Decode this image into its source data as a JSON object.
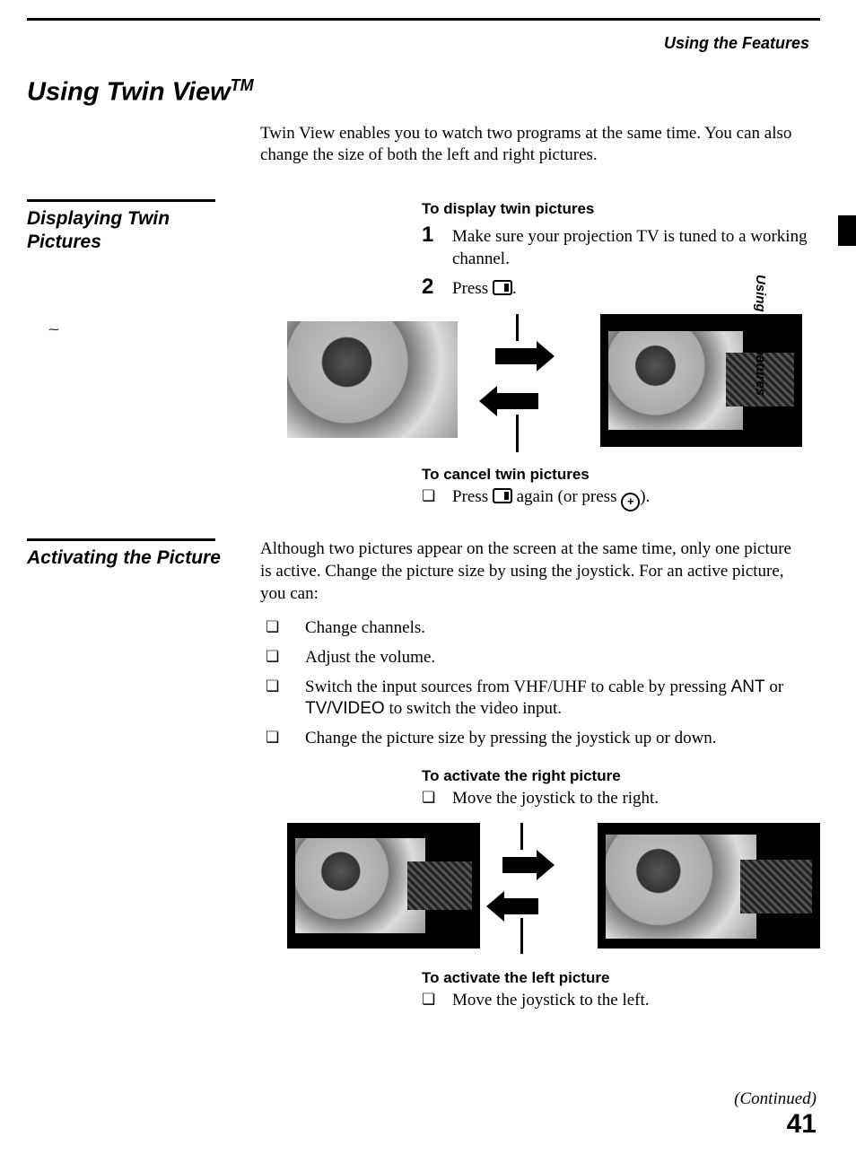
{
  "running_head": "Using the Features",
  "thumb_label": "Using the Features",
  "title_main": "Using Twin View",
  "title_tm": "TM",
  "intro": "Twin View enables you to watch two programs at the same time. You can also change the size of both the left and right pictures.",
  "section1": {
    "side_title": "Displaying Twin Pictures",
    "heading_a": "To display twin pictures",
    "steps": [
      {
        "n": "1",
        "t": "Make sure your projection TV is tuned to a working channel."
      },
      {
        "n": "2",
        "t_before": "Press ",
        "t_after": "."
      }
    ],
    "heading_b": "To cancel twin pictures",
    "cancel_before": "Press ",
    "cancel_mid": " again (or press ",
    "cancel_after": ")."
  },
  "section2": {
    "side_title": "Activating the Picture",
    "para": "Although two pictures appear on the screen at the same time, only one picture is active. Change the picture size by using the joystick. For an active picture, you can:",
    "bullets": [
      "Change channels.",
      "Adjust the volume.",
      "Switch the input sources from VHF/UHF to cable by pressing ANT or TV/VIDEO to switch the video input.",
      "Change the picture size by pressing the joystick up or down."
    ],
    "heading_a": "To activate the right picture",
    "act_right": "Move the joystick to the right.",
    "heading_b": "To activate the left picture",
    "act_left": "Move the joystick to the left."
  },
  "continued": "(Continued)",
  "page_number": "41",
  "bullet_glyph": "❏",
  "restore_glyph": "+"
}
